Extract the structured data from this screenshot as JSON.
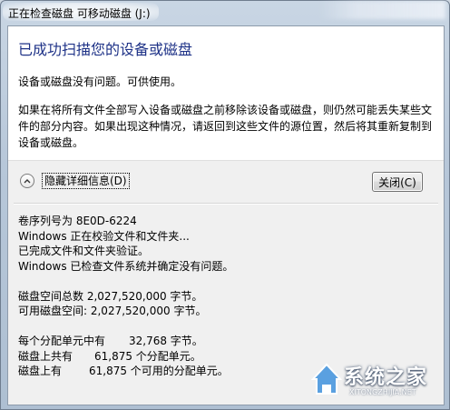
{
  "window": {
    "title": "正在检查磁盘 可移动磁盘 (J:)"
  },
  "summary": {
    "headline": "已成功扫描您的设备或磁盘",
    "status": "设备或磁盘没有问题。可供使用。",
    "warning_lines": [
      "如果在将所有文件全部写入设备或磁盘之前移除该设备或磁盘，则仍然可能丢失某些文",
      "件的部分内容。如果出现这种情况，请返回到这些文件的源位置，然后将其重新复制到",
      "设备或磁盘。"
    ]
  },
  "details_toggle": {
    "label": "隐藏详细信息(D)",
    "icon": "chevron-up-icon"
  },
  "close_button": {
    "label": "关闭(C)"
  },
  "log": {
    "serial": "卷序列号为 8E0D-6224",
    "verifying": "Windows 正在校验文件和文件夹...",
    "verified": "已完成文件和文件夹验证。",
    "checked": "Windows 已检查文件系统并确定没有问题。",
    "total_space": "磁盘空间总数 2,027,520,000 字节。",
    "available_space": "可用磁盘空间: 2,027,520,000 字节。",
    "alloc_unit_label": "每个分配单元中有",
    "alloc_unit_value": "32,768 字节。",
    "total_units_label": "磁盘上共有",
    "total_units_value": "61,875 个分配单元。",
    "free_units_label": "磁盘上有",
    "free_units_value": "61,875 个可用的分配单元。"
  },
  "watermark": {
    "text": "系统之家",
    "url": "XITONGZHIJIA.NET"
  },
  "colors": {
    "headline": "#1e3287",
    "client_bg": "#f0f0f0",
    "panel_bg": "#ffffff"
  }
}
